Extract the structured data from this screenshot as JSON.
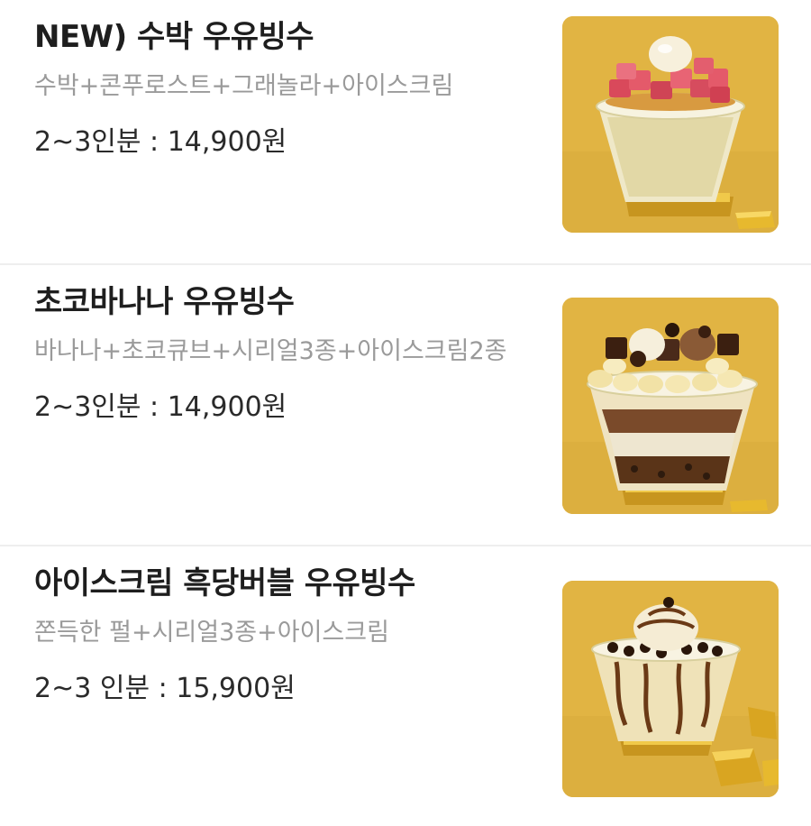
{
  "menu": {
    "items": [
      {
        "name": "NEW) 수박 우유빙수",
        "description": "수박+콘푸로스트+그래놀라+아이스크림",
        "price": "2~3인분 : 14,900원",
        "image_icon": "watermelon-milk-bingsu-photo"
      },
      {
        "name": "초코바나나 우유빙수",
        "description": "바나나+초코큐브+시리얼3종+아이스크림2종",
        "price": "2~3인분 : 14,900원",
        "image_icon": "choco-banana-milk-bingsu-photo"
      },
      {
        "name": "아이스크림 흑당버블 우유빙수",
        "description": "쫀득한 펄+시리얼3종+아이스크림",
        "price": "2~3 인분 : 15,900원",
        "image_icon": "black-sugar-bubble-milk-bingsu-photo"
      }
    ]
  },
  "colors": {
    "photo_background": "#e1b443",
    "gold_bar": "#d9a521",
    "watermelon": "#e45a6a",
    "chocolate": "#4a2a1a",
    "banana": "#f2e2a6",
    "ice": "#f1ead1",
    "title_text": "#1e1e1e",
    "description_text": "#9a9a9a",
    "divider": "#eeeeee"
  }
}
